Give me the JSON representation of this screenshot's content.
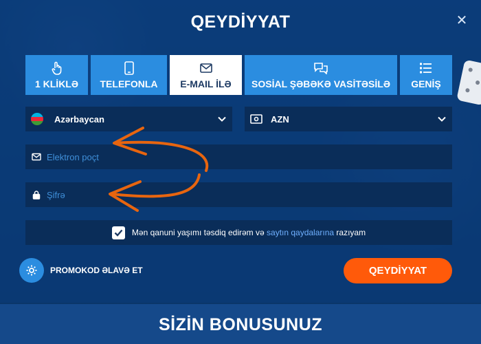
{
  "modal": {
    "title": "QEYDİYYAT",
    "close_icon": "close-icon"
  },
  "tabs": [
    {
      "label": "1 KLİKLƏ",
      "icon": "hand-pointer-icon",
      "active": false
    },
    {
      "label": "TELEFONLA",
      "icon": "phone-icon",
      "active": false
    },
    {
      "label": "E-MAIL İLƏ",
      "icon": "envelope-icon",
      "active": true
    },
    {
      "label": "SOSİAL ŞƏBƏKƏ VASİTƏSİLƏ",
      "icon": "chat-icon",
      "active": false
    },
    {
      "label": "GENİŞ",
      "icon": "list-icon",
      "active": false
    }
  ],
  "form": {
    "country": {
      "value": "Azərbaycan",
      "icon": "azerbaijan-flag-icon"
    },
    "currency": {
      "value": "AZN",
      "icon": "money-icon"
    },
    "email": {
      "placeholder": "Elektron poçt",
      "icon": "envelope-icon"
    },
    "password": {
      "placeholder": "Şifrə",
      "icon": "lock-icon"
    },
    "agree": {
      "text_before": "Mən qanuni yaşımı təsdiq edirəm və ",
      "link": "saytın qaydalarına",
      "text_after": " razıyam",
      "checked": true
    }
  },
  "promo": {
    "label": "PROMOKOD ƏLAVƏ ET",
    "icon": "gear-icon"
  },
  "submit": {
    "label": "QEYDİYYAT",
    "color": "#ff5a0a"
  },
  "bonus": {
    "title": "SİZİN BONUSUNUZ"
  },
  "colors": {
    "accent": "#2b8de0",
    "field_bg": "#0a2d59",
    "annotation_arrow": "#e8650f"
  }
}
